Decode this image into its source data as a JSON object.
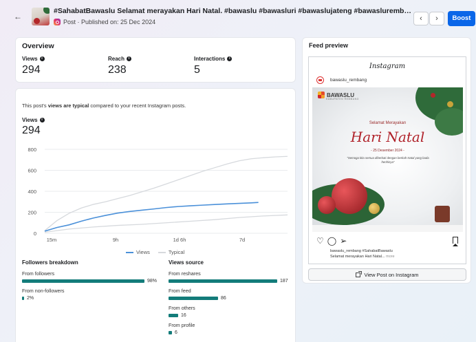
{
  "header": {
    "title": "#SahabatBawaslu Selamat merayakan Hari Natal. #bawaslu #bawasluri #bawaslujateng #bawaslurembang #bawaslumeng...",
    "meta": "Post · Published on: 25 Dec 2024",
    "back_icon": "←",
    "prev_icon": "‹",
    "next_icon": "›",
    "boost_label": "Boost"
  },
  "overview": {
    "title": "Overview",
    "metrics": [
      {
        "label": "Views",
        "value": "294"
      },
      {
        "label": "Reach",
        "value": "238"
      },
      {
        "label": "Interactions",
        "value": "5"
      }
    ]
  },
  "views": {
    "typical_pre": "This post's ",
    "typical_bold": "views are typical",
    "typical_post": " compared to your recent Instagram posts.",
    "label": "Views",
    "value": "294",
    "legend_views": "Views",
    "legend_typical": "Typical"
  },
  "chart_data": {
    "type": "line",
    "x_ticks": [
      "15m",
      "9h",
      "1d 6h",
      "7d"
    ],
    "y_ticks": [
      0,
      200,
      400,
      600,
      800
    ],
    "ylim": [
      0,
      800
    ],
    "series": [
      {
        "name": "Views",
        "color": "#4a90d9",
        "points": [
          [
            0,
            20
          ],
          [
            0.05,
            55
          ],
          [
            0.1,
            80
          ],
          [
            0.15,
            115
          ],
          [
            0.2,
            145
          ],
          [
            0.25,
            170
          ],
          [
            0.3,
            192
          ],
          [
            0.35,
            208
          ],
          [
            0.4,
            220
          ],
          [
            0.45,
            232
          ],
          [
            0.5,
            245
          ],
          [
            0.55,
            255
          ],
          [
            0.6,
            262
          ],
          [
            0.65,
            268
          ],
          [
            0.7,
            274
          ],
          [
            0.75,
            280
          ],
          [
            0.8,
            285
          ],
          [
            0.85,
            290
          ],
          [
            0.88,
            294
          ]
        ]
      },
      {
        "name": "Typical",
        "color": "#d6d9dd",
        "points": [
          [
            0,
            25
          ],
          [
            0.05,
            120
          ],
          [
            0.1,
            190
          ],
          [
            0.15,
            240
          ],
          [
            0.2,
            275
          ],
          [
            0.25,
            300
          ],
          [
            0.3,
            330
          ],
          [
            0.35,
            360
          ],
          [
            0.4,
            395
          ],
          [
            0.45,
            430
          ],
          [
            0.5,
            470
          ],
          [
            0.55,
            510
          ],
          [
            0.6,
            550
          ],
          [
            0.65,
            590
          ],
          [
            0.7,
            625
          ],
          [
            0.75,
            660
          ],
          [
            0.8,
            690
          ],
          [
            0.85,
            710
          ],
          [
            0.9,
            720
          ],
          [
            0.95,
            728
          ],
          [
            1.0,
            733
          ]
        ]
      },
      {
        "name": "Typical",
        "color": "#d6d9dd",
        "points": [
          [
            0,
            10
          ],
          [
            0.1,
            40
          ],
          [
            0.2,
            60
          ],
          [
            0.3,
            75
          ],
          [
            0.4,
            85
          ],
          [
            0.5,
            100
          ],
          [
            0.6,
            115
          ],
          [
            0.7,
            130
          ],
          [
            0.8,
            150
          ],
          [
            0.9,
            165
          ],
          [
            1.0,
            175
          ]
        ]
      }
    ]
  },
  "followers": {
    "title": "Followers breakdown",
    "rows": [
      {
        "label": "From followers",
        "value": "98%",
        "pct": 98
      },
      {
        "label": "From non-followers",
        "value": "2%",
        "pct": 2
      }
    ]
  },
  "sources": {
    "title": "Views source",
    "rows": [
      {
        "label": "From reshares",
        "value": "187",
        "num": 187
      },
      {
        "label": "From feed",
        "value": "86",
        "num": 86
      },
      {
        "label": "From others",
        "value": "16",
        "num": 16
      },
      {
        "label": "From profile",
        "value": "6",
        "num": 6
      }
    ]
  },
  "feed": {
    "title": "Feed preview",
    "app_name": "Instagram",
    "username": "bawaslu_rembang",
    "brand": "BAWASLU",
    "sub_brand": "KABUPATEN REMBANG",
    "greeting": "Selamat Merayakan",
    "script_title": "Hari Natal",
    "date": "- 25 Desember 2024 -",
    "quote": "\"Semoga kita semua diberkati dengan berkah Natal yang bada henhinya\"",
    "caption_line1": "bawaslu_rembang #SahabatBawaslu",
    "caption_line2": "Selamat merayakan Hari Natal... ",
    "caption_more": "more",
    "view_button": "View Post on Instagram"
  }
}
